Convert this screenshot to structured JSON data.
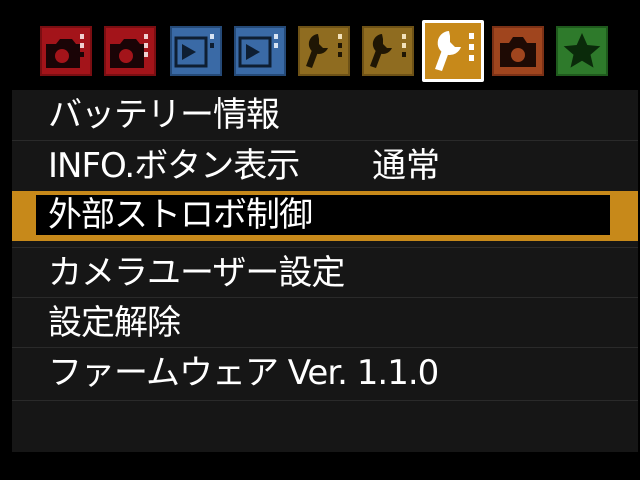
{
  "colors": {
    "accent": "#c7891a",
    "shooting_tab": "#c0161c",
    "playback_tab": "#3a6aa6",
    "setup_tab": "#b78a2c",
    "live_view_tab": "#c8502a",
    "mymenu_tab": "#3a8a36",
    "menu_bg": "#161616",
    "text": "#ffffff"
  },
  "tabs": [
    {
      "icon": "camera-icon",
      "kind": "shooting",
      "index": "1",
      "selected": false
    },
    {
      "icon": "camera-icon",
      "kind": "shooting",
      "index": "2",
      "selected": false
    },
    {
      "icon": "playback-icon",
      "kind": "playback",
      "index": "1",
      "selected": false
    },
    {
      "icon": "playback-icon",
      "kind": "playback",
      "index": "2",
      "selected": false
    },
    {
      "icon": "wrench-icon",
      "kind": "setup",
      "index": "1",
      "selected": false
    },
    {
      "icon": "wrench-icon",
      "kind": "setup",
      "index": "2",
      "selected": false
    },
    {
      "icon": "wrench-icon",
      "kind": "setup",
      "index": "3",
      "selected": true
    },
    {
      "icon": "live-view-camera-icon",
      "kind": "live_view",
      "index": "",
      "selected": false
    },
    {
      "icon": "star-icon",
      "kind": "my_menu",
      "index": "",
      "selected": false
    }
  ],
  "menu": {
    "items": [
      {
        "label": "バッテリー情報",
        "value": "",
        "selected": false
      },
      {
        "label": "INFO.ボタン表示",
        "value": "通常",
        "selected": false
      },
      {
        "label": "外部ストロボ制御",
        "value": "",
        "selected": true
      },
      {
        "label": "カメラユーザー設定",
        "value": "",
        "selected": false
      },
      {
        "label": "設定解除",
        "value": "",
        "selected": false
      },
      {
        "label": "ファームウェア Ver. 1.1.0",
        "value": "",
        "selected": false
      }
    ]
  }
}
